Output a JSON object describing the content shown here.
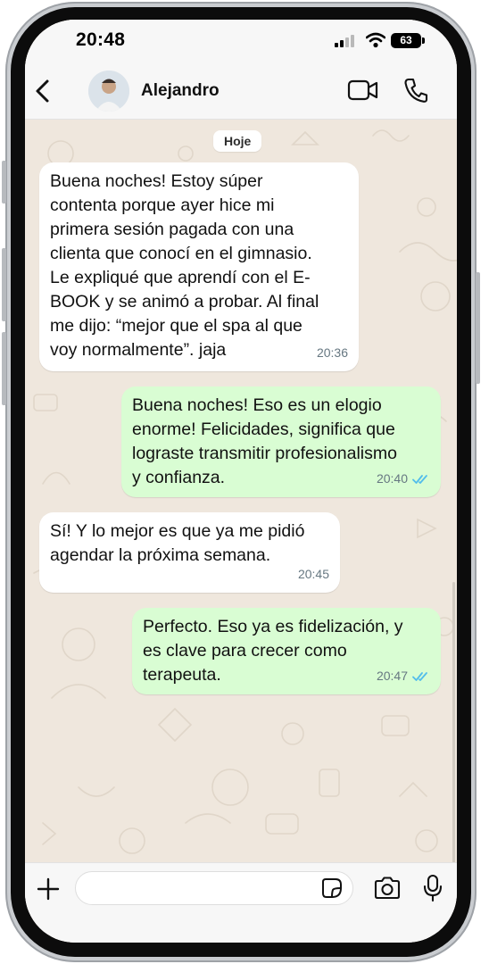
{
  "status_bar": {
    "time": "20:48",
    "battery": "63"
  },
  "header": {
    "contact_name": "Alejandro"
  },
  "chat": {
    "date_divider": "Hoje",
    "messages": [
      {
        "direction": "incoming",
        "text": "Buena noches! Estoy súper\ncontenta porque ayer hice mi\nprimera sesión pagada con una\nclienta que conocí en el gimnasio.\nLe expliqué que aprendí con el E-\nBOOK  y se animó a probar. Al final\nme dijo: “mejor que el spa al que\nvoy normalmente”. jaja",
        "time": "20:36"
      },
      {
        "direction": "outgoing",
        "text": "Buena noches! Eso es un elogio\nenorme! Felicidades, significa que\nlograste transmitir profesionalismo\ny confianza.",
        "time": "20:40",
        "status": "read"
      },
      {
        "direction": "incoming",
        "text": "Sí! Y lo mejor es que ya me pidió\nagendar la próxima semana.",
        "time": "20:45"
      },
      {
        "direction": "outgoing",
        "text": "Perfecto. Eso ya es fidelización, y\nes clave para crecer como\nterapeuta.",
        "time": "20:47",
        "status": "read"
      }
    ]
  },
  "composer": {
    "value": ""
  },
  "colors": {
    "wallpaper": "#efe7dd",
    "incoming_bubble": "#ffffff",
    "outgoing_bubble": "#d9fdd3",
    "read_ticks": "#53bdeb",
    "bars": "#f7f7f7"
  },
  "icons": [
    "back-chevron",
    "avatar-photo",
    "video-camera",
    "phone",
    "plus",
    "sticker",
    "camera",
    "microphone",
    "double-check"
  ]
}
